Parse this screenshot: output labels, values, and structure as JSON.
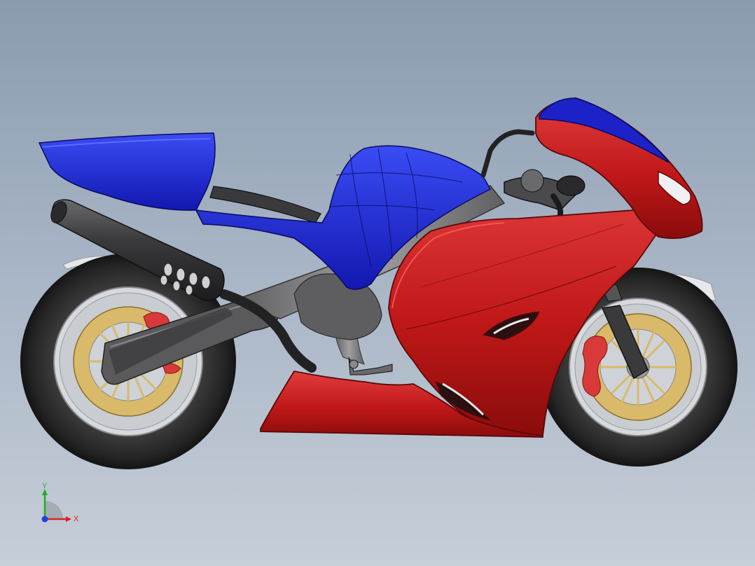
{
  "viewport": {
    "background_top": "#8a9bb0",
    "background_bottom": "#c6ced8"
  },
  "model": {
    "colors": {
      "fairing_red": "#c41a1a",
      "fairing_red_light": "#e03a3a",
      "fairing_red_dark": "#8e0d0d",
      "body_blue": "#1620c8",
      "body_blue_light": "#3a4cf0",
      "tire": "#2c2c2c",
      "rim_gold": "#d9b96a",
      "frame_gray": "#7e7e80",
      "exhaust": "#3a3a3c",
      "caliper": "#d83a3a"
    }
  },
  "triad": {
    "x_label": "X",
    "y_label": "Y",
    "x_color": "#e02020",
    "y_color": "#20b020",
    "z_color": "#2040e0"
  }
}
